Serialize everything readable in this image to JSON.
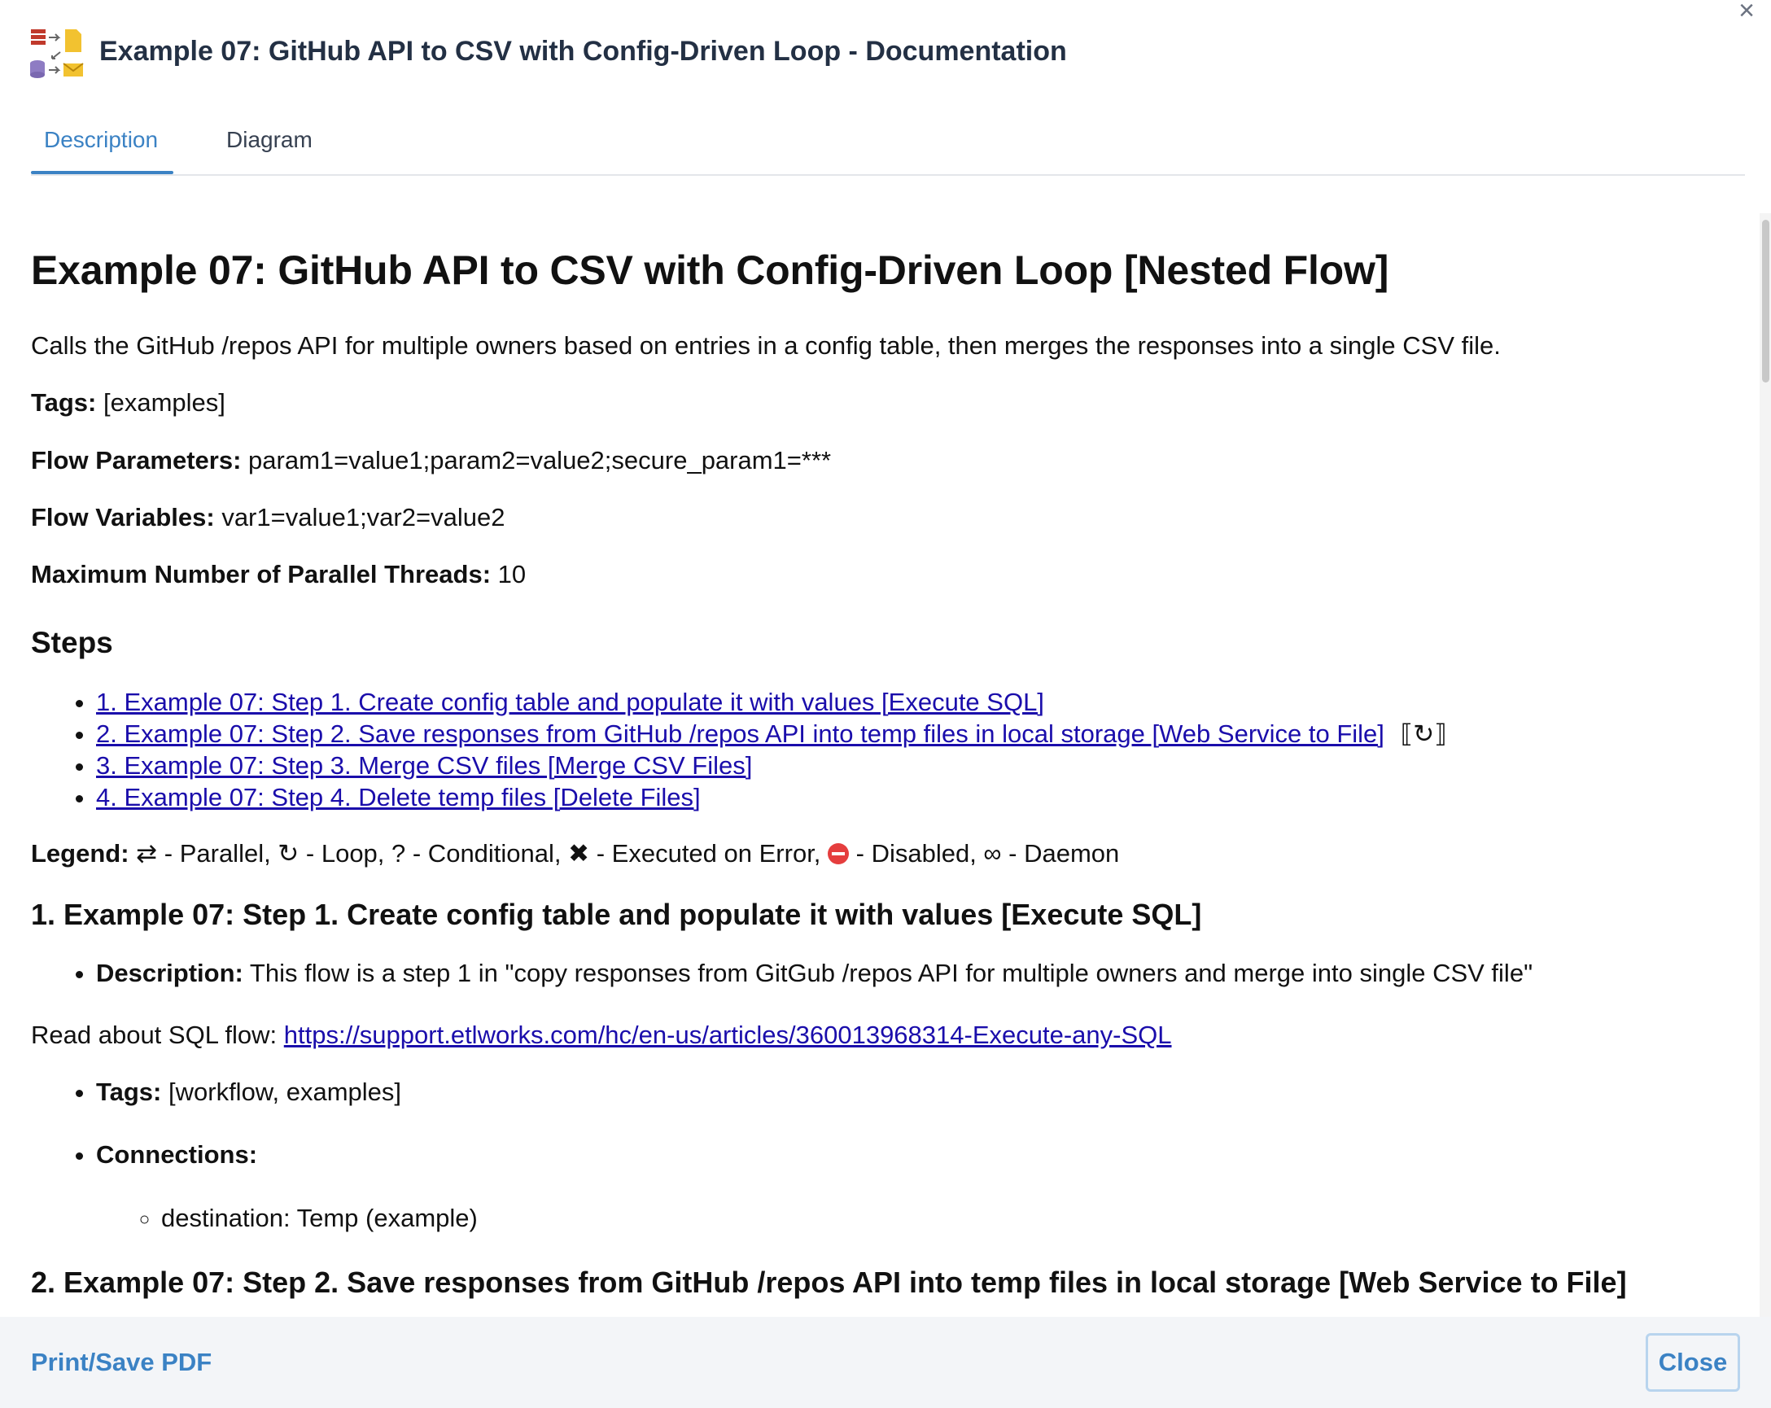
{
  "dialog": {
    "title": "Example 07: GitHub API to CSV with Config-Driven Loop - Documentation",
    "close_icon": "×"
  },
  "tabs": [
    {
      "label": "Description",
      "active": true
    },
    {
      "label": "Diagram",
      "active": false
    }
  ],
  "doc": {
    "heading": "Example 07: GitHub API to CSV with Config-Driven Loop [Nested Flow]",
    "summary": "Calls the GitHub /repos API for multiple owners based on entries in a config table, then merges the responses into a single CSV file.",
    "tags_label": "Tags:",
    "tags_value": " [examples]",
    "params_label": "Flow Parameters:",
    "params_value": " param1=value1;param2=value2;secure_param1=***",
    "vars_label": "Flow Variables:",
    "vars_value": " var1=value1;var2=value2",
    "threads_label": "Maximum Number of Parallel Threads:",
    "threads_value": " 10",
    "steps_heading": "Steps",
    "steps": [
      "1. Example 07: Step 1. Create config table and populate it with values [Execute SQL]",
      "2. Example 07: Step 2. Save responses from GitHub /repos API into temp files in local storage [Web Service to File]",
      "3. Example 07: Step 3. Merge CSV files [Merge CSV Files]",
      "4. Example 07: Step 4. Delete temp files [Delete Files]"
    ],
    "step2_marker": "⟦↻⟧",
    "legend_label": "Legend:",
    "legend_parallel": " ⇄ - Parallel, ↻ - Loop, ? - Conditional, ✖ - Executed on Error, ",
    "legend_rest": " - Disabled, ∞ - Daemon",
    "step1_heading": "1. Example 07: Step 1. Create config table and populate it with values [Execute SQL]",
    "step1_desc_label": "Description:",
    "step1_desc_value": " This flow is a step 1 in \"copy responses from GitGub /repos API for multiple owners and merge into single CSV file\"",
    "read_about_prefix": "Read about SQL flow: ",
    "read_about_link": "https://support.etlworks.com/hc/en-us/articles/360013968314-Execute-any-SQL",
    "step1_tags_label": "Tags:",
    "step1_tags_value": " [workflow, examples]",
    "step1_conn_label": "Connections:",
    "step1_conn_item": "destination: Temp (example)",
    "step2_heading": "2. Example 07: Step 2. Save responses from GitHub /repos API into temp files in local storage [Web Service to File]"
  },
  "footer": {
    "print_label": "Print/Save PDF",
    "close_label": "Close"
  },
  "colors": {
    "accent": "#3b82c4",
    "title": "#233044",
    "link": "#1a0dab",
    "footer_bg": "#f3f5f8"
  },
  "icons": {
    "app": "etl-flow-icon",
    "close": "close-icon",
    "disabled": "disabled-icon"
  }
}
